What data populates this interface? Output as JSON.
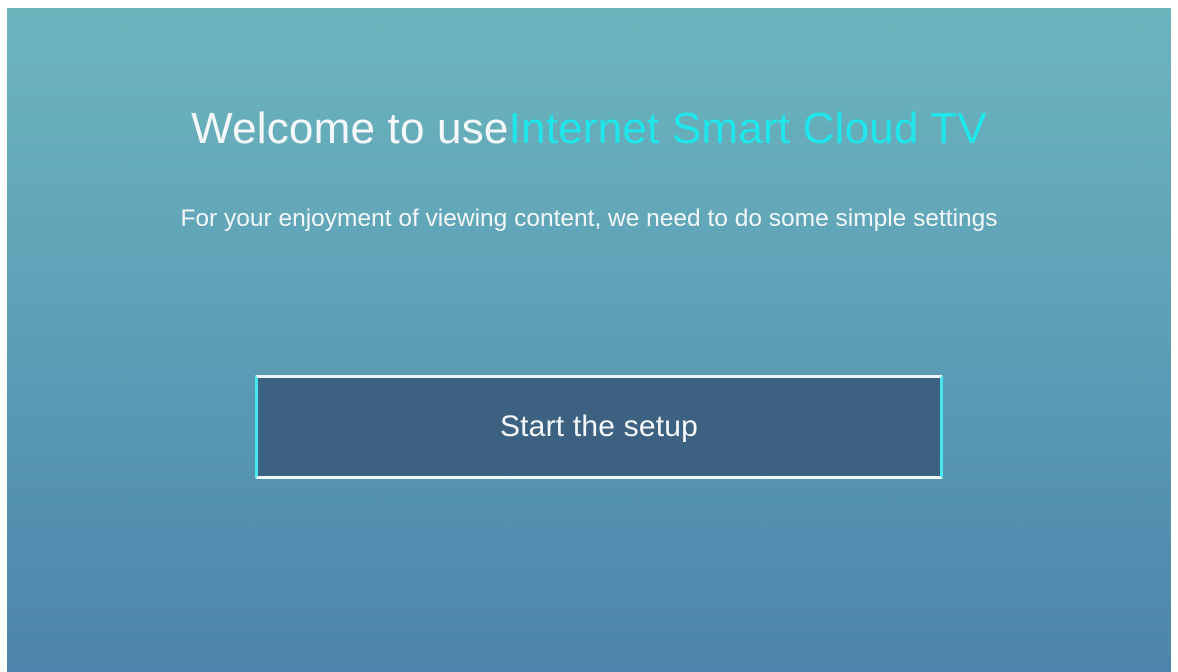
{
  "welcome": {
    "prefix": "Welcome to use",
    "brand": "Internet Smart Cloud TV",
    "brand_color": "#1ee6ea"
  },
  "subtitle": "For your enjoyment of viewing content, we need to do some simple settings",
  "start_button": {
    "label": "Start the setup",
    "accent": "#44e8ee"
  },
  "colors": {
    "background_top": "#6db5bd",
    "background_bottom": "#4d84ab",
    "button_fill": "#3d6180"
  }
}
